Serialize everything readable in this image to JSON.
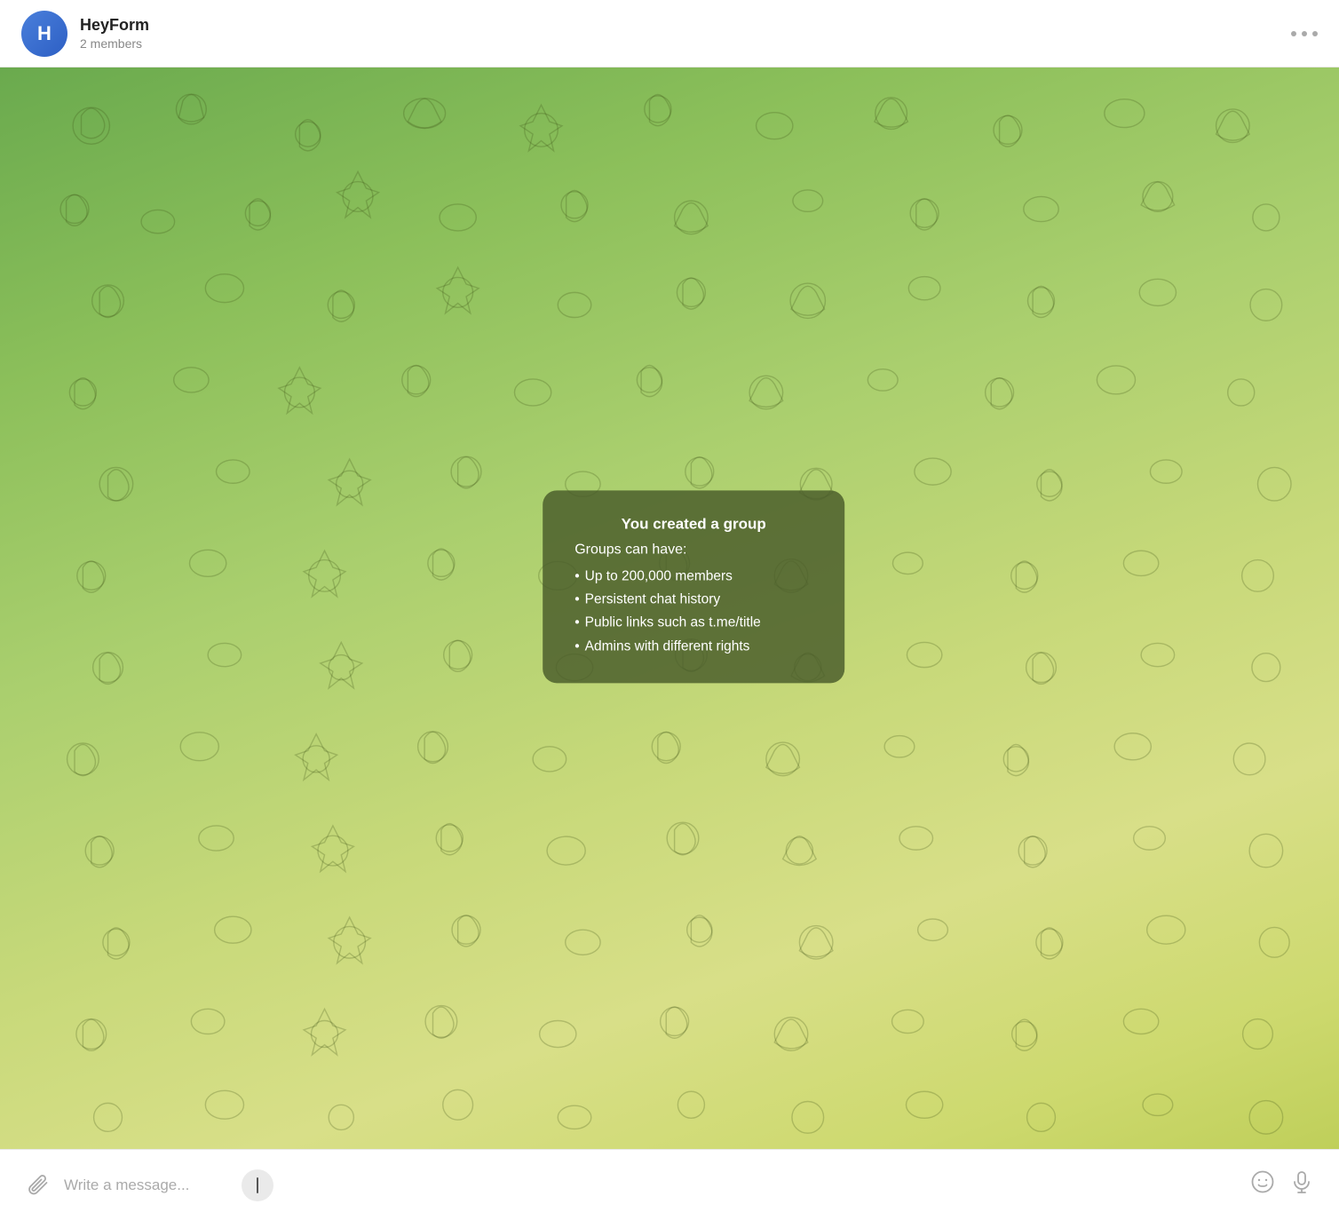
{
  "header": {
    "avatar_letter": "H",
    "title": "HeyForm",
    "subtitle": "2 members",
    "menu_label": "More options"
  },
  "chat": {
    "background_gradient_start": "#6aaa4e",
    "background_gradient_end": "#bfcf5a"
  },
  "info_bubble": {
    "title": "You created a group",
    "subtitle": "Groups can have:",
    "items": [
      "Up to 200,000 members",
      "Persistent chat history",
      "Public links such as t.me/title",
      "Admins with different rights"
    ]
  },
  "bottom_bar": {
    "input_placeholder": "Write a message...",
    "attach_icon": "📎",
    "emoji_icon": "🙂",
    "mic_icon": "🎙"
  }
}
